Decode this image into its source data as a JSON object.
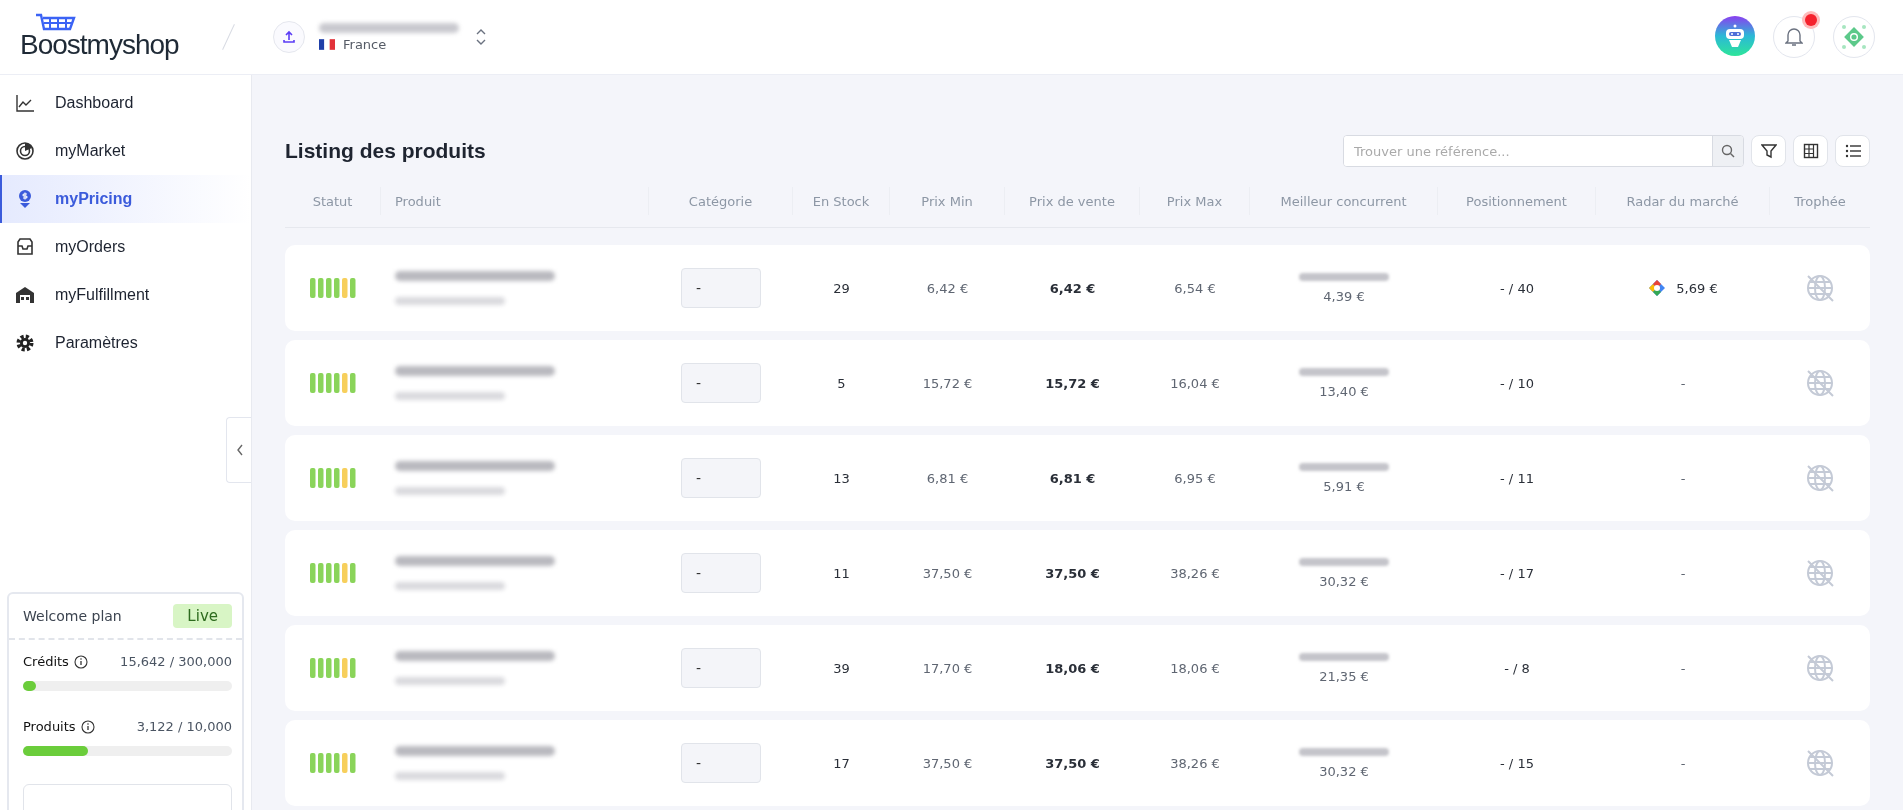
{
  "header": {
    "logo": "Boostmyshop",
    "store": {
      "country": "France"
    },
    "notifications": {
      "unread": true
    }
  },
  "sidebar": {
    "items": [
      {
        "label": "Dashboard",
        "selected": false
      },
      {
        "label": "myMarket",
        "selected": false
      },
      {
        "label": "myPricing",
        "selected": true
      },
      {
        "label": "myOrders",
        "selected": false
      },
      {
        "label": "myFulfillment",
        "selected": false
      },
      {
        "label": "Paramètres",
        "selected": false
      }
    ],
    "plan": {
      "name": "Welcome plan",
      "status": "Live",
      "quotas": [
        {
          "label": "Crédits",
          "value": "15,642 / 300,000",
          "level": 0.052
        },
        {
          "label": "Produits",
          "value": "3,122 / 10,000",
          "level": 0.31
        }
      ]
    }
  },
  "page": {
    "title": "Listing des produits",
    "search": {
      "placeholder": "Trouver une référence..."
    }
  },
  "table": {
    "columns": [
      "Statut",
      "Produit",
      "Catégorie",
      "En Stock",
      "Prix Min",
      "Prix de vente",
      "Prix Max",
      "Meilleur concurrent",
      "Positionnement",
      "Radar du marché",
      "Trophée"
    ],
    "rows": [
      {
        "category": "-",
        "stock": "29",
        "min_price": "6,42 €",
        "sale_price": "6,42 €",
        "max_price": "6,54 €",
        "competitor_price": "4,39 €",
        "positioning": "- / 40",
        "radar": {
          "kind": "google",
          "value": "5,69 €"
        }
      },
      {
        "category": "-",
        "stock": "5",
        "min_price": "15,72 €",
        "sale_price": "15,72 €",
        "max_price": "16,04 €",
        "competitor_price": "13,40 €",
        "positioning": "- / 10",
        "radar": {
          "kind": "none",
          "value": "-"
        }
      },
      {
        "category": "-",
        "stock": "13",
        "min_price": "6,81 €",
        "sale_price": "6,81 €",
        "max_price": "6,95 €",
        "competitor_price": "5,91 €",
        "positioning": "- / 11",
        "radar": {
          "kind": "none",
          "value": "-"
        }
      },
      {
        "category": "-",
        "stock": "11",
        "min_price": "37,50 €",
        "sale_price": "37,50 €",
        "max_price": "38,26 €",
        "competitor_price": "30,32 €",
        "positioning": "- / 17",
        "radar": {
          "kind": "none",
          "value": "-"
        }
      },
      {
        "category": "-",
        "stock": "39",
        "min_price": "17,70 €",
        "sale_price": "18,06 €",
        "max_price": "18,06 €",
        "competitor_price": "21,35 €",
        "positioning": "- / 8",
        "radar": {
          "kind": "none",
          "value": "-"
        }
      },
      {
        "category": "-",
        "stock": "17",
        "min_price": "37,50 €",
        "sale_price": "37,50 €",
        "max_price": "38,26 €",
        "competitor_price": "30,32 €",
        "positioning": "- / 15",
        "radar": {
          "kind": "none",
          "value": "-"
        }
      }
    ]
  }
}
